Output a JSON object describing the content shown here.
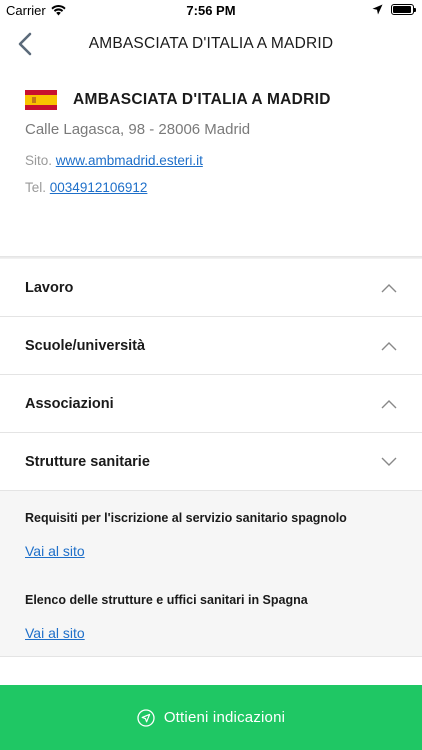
{
  "status_bar": {
    "carrier": "Carrier",
    "time": "7:56 PM",
    "battery_level": 0.95
  },
  "nav": {
    "title": "AMBASCIATA D'ITALIA A MADRID",
    "back_icon": "chevron-left-icon"
  },
  "embassy": {
    "flag": "spain-flag-icon",
    "name": "AMBASCIATA D'ITALIA A MADRID",
    "address": "Calle Lagasca, 98 - 28006 Madrid",
    "site_label": "Sito.",
    "site_url": "www.ambmadrid.esteri.it",
    "tel_label": "Tel.",
    "tel_number": "0034912106912"
  },
  "accordion": {
    "items": [
      {
        "label": "Lavoro",
        "state": "collapsed"
      },
      {
        "label": "Scuole/università",
        "state": "collapsed"
      },
      {
        "label": "Associazioni",
        "state": "collapsed"
      },
      {
        "label": "Strutture sanitarie",
        "state": "expanded"
      }
    ],
    "expanded_links": [
      {
        "title": "Requisiti per l'iscrizione al servizio sanitario spagnolo",
        "link_label": "Vai al sito"
      },
      {
        "title": "Elenco delle strutture e uffici sanitari in Spagna",
        "link_label": "Vai al sito"
      }
    ]
  },
  "cta": {
    "label": "Ottieni indicazioni",
    "icon": "navigation-icon"
  },
  "colors": {
    "accent_green": "#1fc764",
    "link_blue": "#1e6fc9"
  }
}
